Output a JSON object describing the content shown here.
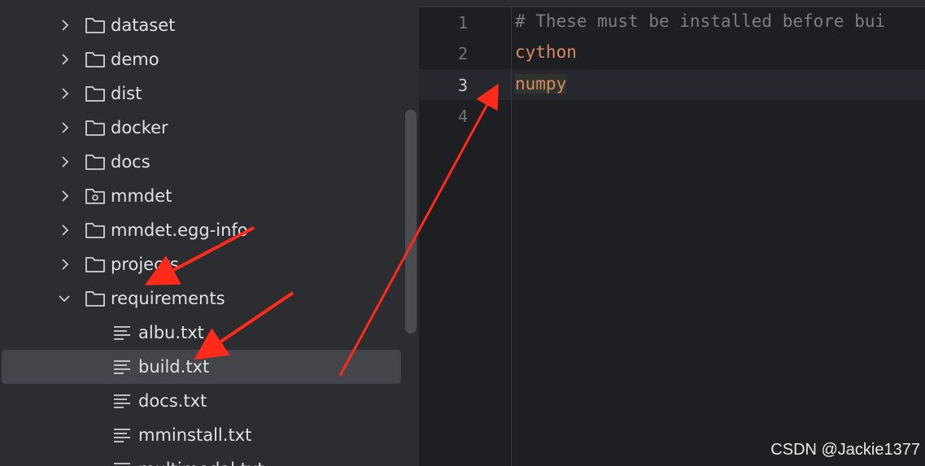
{
  "project_tree": {
    "items": [
      {
        "type": "folder",
        "label": "dataset",
        "expanded": false
      },
      {
        "type": "folder",
        "label": "demo",
        "expanded": false
      },
      {
        "type": "folder",
        "label": "dist",
        "expanded": false
      },
      {
        "type": "folder",
        "label": "docker",
        "expanded": false
      },
      {
        "type": "folder",
        "label": "docs",
        "expanded": false
      },
      {
        "type": "package",
        "label": "mmdet",
        "expanded": false
      },
      {
        "type": "folder",
        "label": "mmdet.egg-info",
        "expanded": false
      },
      {
        "type": "folder",
        "label": "projects",
        "expanded": false
      },
      {
        "type": "folder",
        "label": "requirements",
        "expanded": true
      },
      {
        "type": "file",
        "label": "albu.txt"
      },
      {
        "type": "file",
        "label": "build.txt",
        "selected": true
      },
      {
        "type": "file",
        "label": "docs.txt"
      },
      {
        "type": "file",
        "label": "mminstall.txt"
      },
      {
        "type": "file",
        "label": "multimodal.txt"
      }
    ]
  },
  "editor": {
    "lines": [
      {
        "number": "1",
        "text": "# These must be installed before bui",
        "kind": "comment"
      },
      {
        "number": "2",
        "text": "cython",
        "kind": "req"
      },
      {
        "number": "3",
        "text": "numpy",
        "kind": "req",
        "current": true
      },
      {
        "number": "4",
        "text": "",
        "kind": "req"
      }
    ]
  },
  "watermark": "CSDN @Jackie1377",
  "colors": {
    "tree_bg": "#2b2d30",
    "editor_bg": "#1e1f22",
    "selection": "#43454a",
    "text": "#dfe1e5",
    "comment": "#7a7e85",
    "string": "#d68b5e",
    "annotation_arrow": "#ff2a1a"
  }
}
